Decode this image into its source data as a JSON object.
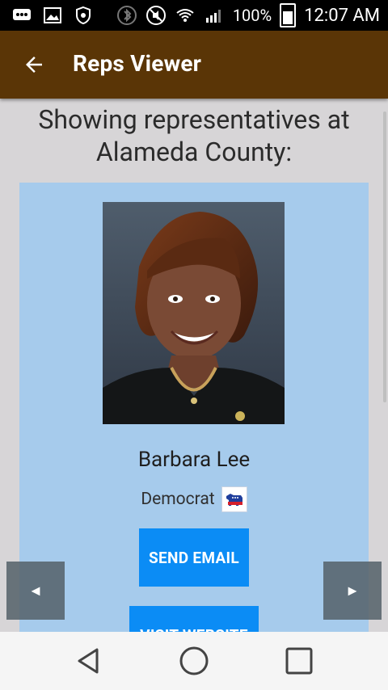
{
  "status": {
    "battery_percent": "100%",
    "time": "12:07 AM"
  },
  "app": {
    "title": "Reps Viewer"
  },
  "content": {
    "heading_line1": "Showing representatives at",
    "heading_line2": "Alameda County:"
  },
  "rep": {
    "name": "Barbara Lee",
    "party": "Democrat"
  },
  "buttons": {
    "send_email": "SEND EMAIL",
    "visit_website": "VISIT WEBSITE"
  },
  "nav": {
    "prev": "◄",
    "next": "►"
  },
  "colors": {
    "appbar": "#5a3506",
    "card": "#a6cbec",
    "button": "#0b8cf5"
  },
  "icons": {
    "status": [
      "message-icon",
      "image-icon",
      "shield-icon",
      "bluetooth-icon",
      "mute-icon",
      "wifi-icon",
      "signal-icon",
      "battery-icon"
    ],
    "app": [
      "back-arrow-icon",
      "democrat-donkey-icon"
    ],
    "system": [
      "nav-back-icon",
      "nav-home-icon",
      "nav-recents-icon"
    ]
  }
}
